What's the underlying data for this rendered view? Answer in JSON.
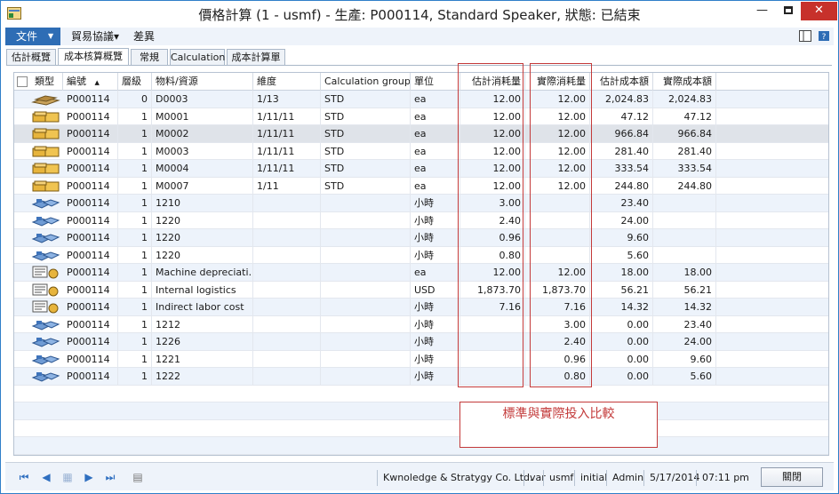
{
  "window": {
    "title": "價格計算 (1 - usmf) - 生產: P000114, Standard Speaker, 狀態: 已結束",
    "minimize": "—",
    "close": "✕"
  },
  "menu": {
    "file": "文件",
    "items": [
      "貿易協議▾",
      "差異"
    ]
  },
  "tabs": [
    "估計概覽",
    "成本核算概覽",
    "常規",
    "Calculation",
    "成本計算單"
  ],
  "columns": [
    "類型",
    "編號",
    "層級",
    "物料/資源",
    "維度",
    "Calculation group",
    "單位",
    "估計消耗量",
    "實際消耗量",
    "估計成本額",
    "實際成本額"
  ],
  "sort_indicator": "▲",
  "rows": [
    {
      "icon": "bom-icon",
      "id": "P000114",
      "level": "0",
      "item": "D0003",
      "dim": "1/13",
      "group": "STD",
      "unit": "ea",
      "est_qty": "12.00",
      "act_qty": "12.00",
      "est_cost": "2,024.83",
      "act_cost": "2,024.83"
    },
    {
      "icon": "item-icon",
      "id": "P000114",
      "level": "1",
      "item": "M0001",
      "dim": "1/11/11",
      "group": "STD",
      "unit": "ea",
      "est_qty": "12.00",
      "act_qty": "12.00",
      "est_cost": "47.12",
      "act_cost": "47.12"
    },
    {
      "icon": "item-icon",
      "id": "P000114",
      "level": "1",
      "item": "M0002",
      "dim": "1/11/11",
      "group": "STD",
      "unit": "ea",
      "est_qty": "12.00",
      "act_qty": "12.00",
      "est_cost": "966.84",
      "act_cost": "966.84"
    },
    {
      "icon": "item-icon",
      "id": "P000114",
      "level": "1",
      "item": "M0003",
      "dim": "1/11/11",
      "group": "STD",
      "unit": "ea",
      "est_qty": "12.00",
      "act_qty": "12.00",
      "est_cost": "281.40",
      "act_cost": "281.40"
    },
    {
      "icon": "item-icon",
      "id": "P000114",
      "level": "1",
      "item": "M0004",
      "dim": "1/11/11",
      "group": "STD",
      "unit": "ea",
      "est_qty": "12.00",
      "act_qty": "12.00",
      "est_cost": "333.54",
      "act_cost": "333.54"
    },
    {
      "icon": "item-icon",
      "id": "P000114",
      "level": "1",
      "item": "M0007",
      "dim": "1/11",
      "group": "STD",
      "unit": "ea",
      "est_qty": "12.00",
      "act_qty": "12.00",
      "est_cost": "244.80",
      "act_cost": "244.80"
    },
    {
      "icon": "route-icon",
      "id": "P000114",
      "level": "1",
      "item": "1210",
      "dim": "",
      "group": "",
      "unit": "小時",
      "est_qty": "3.00",
      "act_qty": "",
      "est_cost": "23.40",
      "act_cost": ""
    },
    {
      "icon": "route-icon",
      "id": "P000114",
      "level": "1",
      "item": "1220",
      "dim": "",
      "group": "",
      "unit": "小時",
      "est_qty": "2.40",
      "act_qty": "",
      "est_cost": "24.00",
      "act_cost": ""
    },
    {
      "icon": "route-icon",
      "id": "P000114",
      "level": "1",
      "item": "1220",
      "dim": "",
      "group": "",
      "unit": "小時",
      "est_qty": "0.96",
      "act_qty": "",
      "est_cost": "9.60",
      "act_cost": ""
    },
    {
      "icon": "route-icon",
      "id": "P000114",
      "level": "1",
      "item": "1220",
      "dim": "",
      "group": "",
      "unit": "小時",
      "est_qty": "0.80",
      "act_qty": "",
      "est_cost": "5.60",
      "act_cost": ""
    },
    {
      "icon": "indirect-icon",
      "id": "P000114",
      "level": "1",
      "item": "Machine depreciati…",
      "dim": "",
      "group": "",
      "unit": "ea",
      "est_qty": "12.00",
      "act_qty": "12.00",
      "est_cost": "18.00",
      "act_cost": "18.00"
    },
    {
      "icon": "indirect-icon",
      "id": "P000114",
      "level": "1",
      "item": "Internal logistics",
      "dim": "",
      "group": "",
      "unit": "USD",
      "est_qty": "1,873.70",
      "act_qty": "1,873.70",
      "est_cost": "56.21",
      "act_cost": "56.21"
    },
    {
      "icon": "indirect-icon",
      "id": "P000114",
      "level": "1",
      "item": "Indirect labor cost",
      "dim": "",
      "group": "",
      "unit": "小時",
      "est_qty": "7.16",
      "act_qty": "7.16",
      "est_cost": "14.32",
      "act_cost": "14.32"
    },
    {
      "icon": "route-icon",
      "id": "P000114",
      "level": "1",
      "item": "1212",
      "dim": "",
      "group": "",
      "unit": "小時",
      "est_qty": "",
      "act_qty": "3.00",
      "est_cost": "0.00",
      "act_cost": "23.40"
    },
    {
      "icon": "route-icon",
      "id": "P000114",
      "level": "1",
      "item": "1226",
      "dim": "",
      "group": "",
      "unit": "小時",
      "est_qty": "",
      "act_qty": "2.40",
      "est_cost": "0.00",
      "act_cost": "24.00"
    },
    {
      "icon": "route-icon",
      "id": "P000114",
      "level": "1",
      "item": "1221",
      "dim": "",
      "group": "",
      "unit": "小時",
      "est_qty": "",
      "act_qty": "0.96",
      "est_cost": "0.00",
      "act_cost": "9.60"
    },
    {
      "icon": "route-icon",
      "id": "P000114",
      "level": "1",
      "item": "1222",
      "dim": "",
      "group": "",
      "unit": "小時",
      "est_qty": "",
      "act_qty": "0.80",
      "est_cost": "0.00",
      "act_cost": "5.60"
    }
  ],
  "annotation": "標準與實際投入比較",
  "status": {
    "company": "Kwnoledge & Stratygy Co. Ltd.",
    "var": "var",
    "partition": "usmf",
    "layer": "initial",
    "user": "Admin",
    "date": "5/17/2014",
    "time": "07:11 pm",
    "close_button": "關閉"
  },
  "colors": {
    "accent": "#2e6db5",
    "row_alt": "#edf3fb",
    "annotation_red": "#c33a3a",
    "close_red": "#c7312b"
  }
}
